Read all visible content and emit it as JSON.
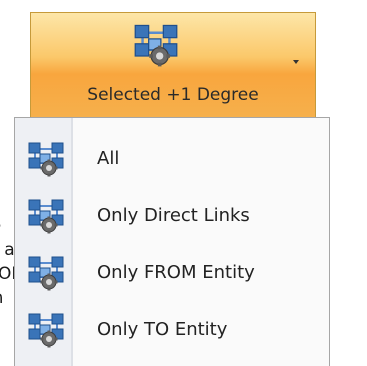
{
  "background_text": [
    "ie",
    "s a",
    "ON",
    "th"
  ],
  "ribbon": {
    "button_label": "Selected +1 Degree",
    "icon": "network-graph-icon",
    "dropdown": "chevron-down-icon"
  },
  "menu": {
    "items": [
      {
        "label": "All",
        "icon": "network-graph-icon"
      },
      {
        "label": "Only Direct Links",
        "icon": "network-graph-icon"
      },
      {
        "label": "Only FROM Entity",
        "icon": "network-graph-icon"
      },
      {
        "label": "Only TO Entity",
        "icon": "network-graph-icon"
      }
    ]
  },
  "colors": {
    "ribbon_pressed": "#f8a63e",
    "menu_bg": "#fafafa",
    "icon_blue": "#3a74b8"
  }
}
